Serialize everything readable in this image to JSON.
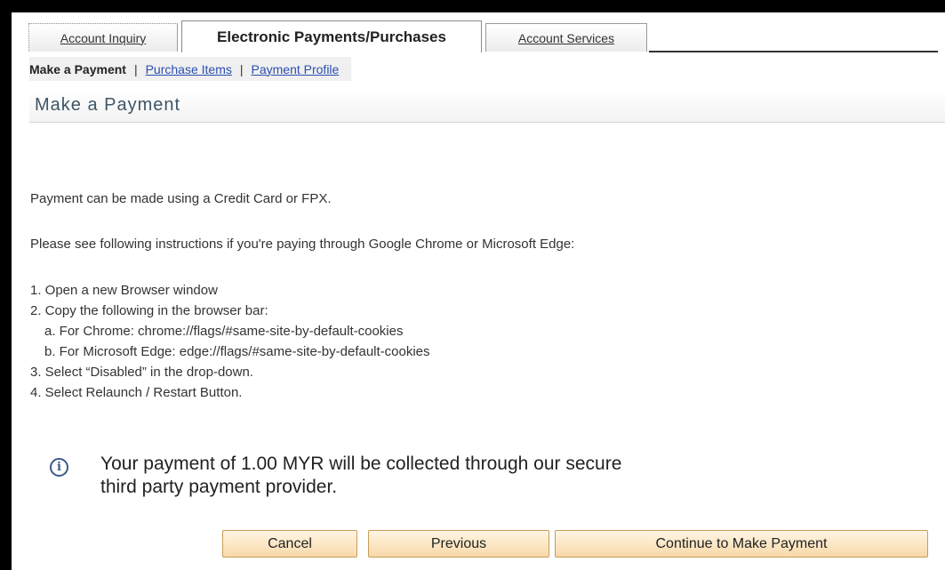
{
  "tabs": [
    {
      "label": "Account Inquiry",
      "active": false
    },
    {
      "label": "Electronic Payments/Purchases",
      "active": true
    },
    {
      "label": "Account Services",
      "active": false
    }
  ],
  "subnav": {
    "current": "Make a Payment",
    "separator": "|",
    "links": [
      "Purchase Items",
      "Payment Profile"
    ]
  },
  "page": {
    "title": "Make a Payment",
    "intro": "Payment can be made using a Credit Card or FPX.",
    "instructions_heading": "Please see following instructions if you're paying through Google Chrome or Microsoft Edge:",
    "steps": [
      "1. Open a new Browser window",
      "2. Copy the following in the browser bar:",
      "a. For Chrome: chrome://flags/#same-site-by-default-cookies",
      "b. For Microsoft Edge: edge://flags/#same-site-by-default-cookies",
      "3. Select “Disabled” in the drop-down.",
      "4. Select Relaunch / Restart Button."
    ],
    "info_icon": "info-icon",
    "info_line1": "Your payment of 1.00 MYR will be collected through our secure",
    "info_line2": "third party payment provider."
  },
  "buttons": {
    "cancel": "Cancel",
    "previous": "Previous",
    "continue": "Continue to Make Payment"
  },
  "colors": {
    "link": "#2a4fb0",
    "title": "#3f5566",
    "button_fill": "#f8d9a8",
    "button_border": "#c79e5a"
  }
}
